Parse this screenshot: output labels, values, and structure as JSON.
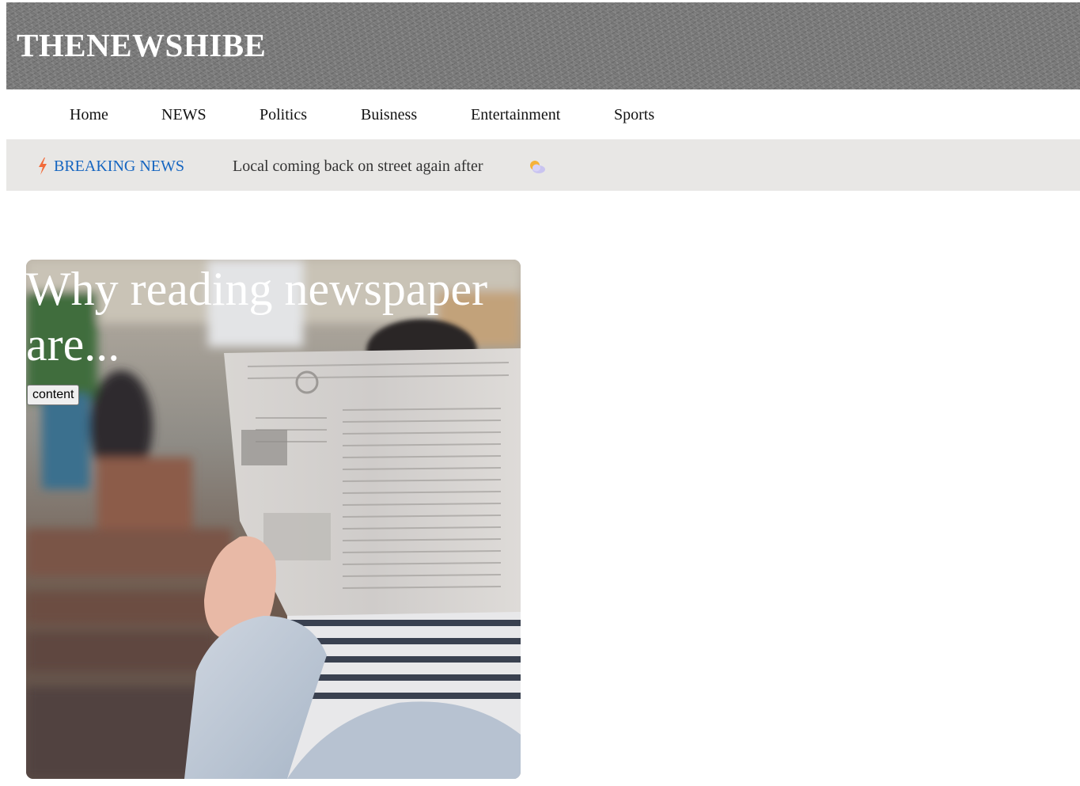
{
  "header": {
    "site_title": "THENEWSHIBE"
  },
  "nav": {
    "items": [
      {
        "label": "Home"
      },
      {
        "label": "NEWS"
      },
      {
        "label": "Politics"
      },
      {
        "label": "Buisness"
      },
      {
        "label": "Entertainment"
      },
      {
        "label": "Sports"
      }
    ]
  },
  "breaking": {
    "icon": "lightning-bolt-icon",
    "label": "BREAKING NEWS",
    "ticker_text": "Local coming back on street again after",
    "weather_icon": "sun-behind-cloud-icon"
  },
  "feature": {
    "title": "Why reading newspaper are...",
    "button_label": "content",
    "image": "person-reading-newspaper-photo"
  },
  "colors": {
    "header_bg": "#7b7b7b",
    "breaking_bar_bg": "#e8e7e5",
    "breaking_label": "#1565c0",
    "bolt": "#f26b3a"
  }
}
